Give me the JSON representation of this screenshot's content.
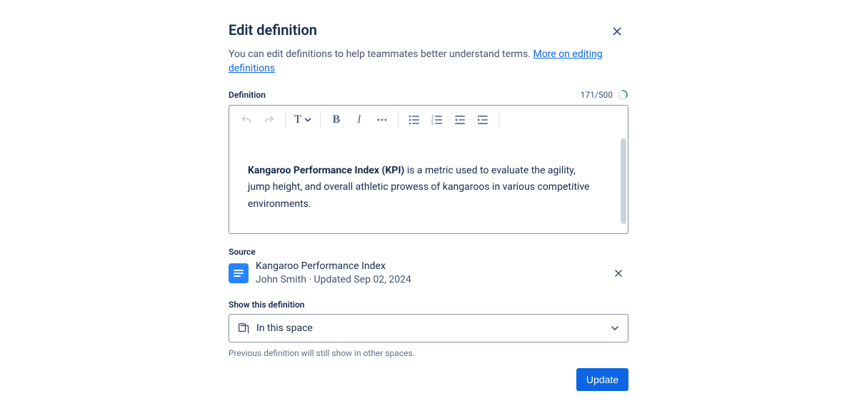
{
  "dialog": {
    "title": "Edit definition",
    "subtitle_text": "You can edit definitions to help teammates better understand terms. ",
    "subtitle_link": "More on editing definitions"
  },
  "definition": {
    "label": "Definition",
    "counter": "171/500",
    "text_style_label": "T",
    "body_bold": "Kangaroo Performance Index (KPI)",
    "body_rest": " is a metric used to evaluate the agility, jump height, and overall athletic prowess of kangaroos in various competitive environments."
  },
  "source": {
    "label": "Source",
    "title": "Kangaroo Performance Index",
    "author": "John Smith",
    "separator": " · ",
    "updated": "Updated Sep 02, 2024"
  },
  "scope": {
    "label": "Show this definition",
    "selected": "In this space",
    "helper": "Previous definition will still show in other spaces."
  },
  "footer": {
    "update": "Update"
  }
}
